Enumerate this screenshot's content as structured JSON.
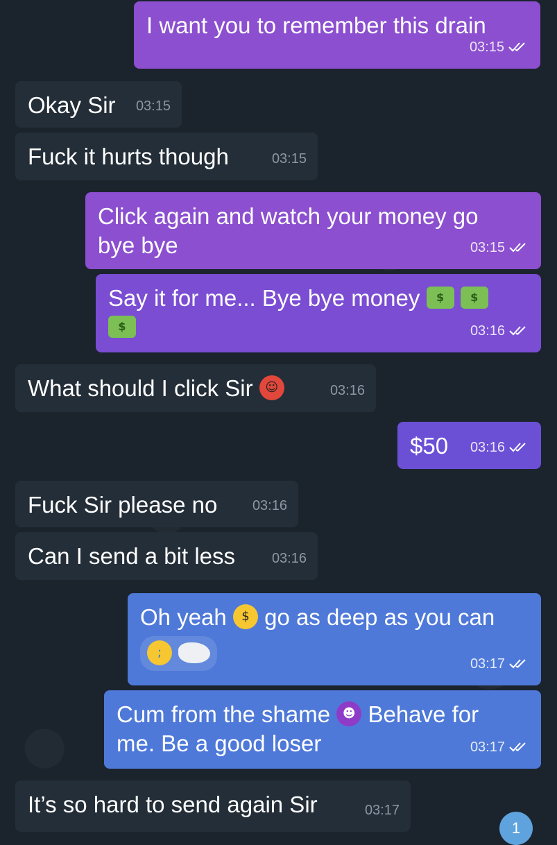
{
  "colors": {
    "background": "#1b232d",
    "incoming": "#242e38",
    "outgoing_purple": "#8b4fcf",
    "outgoing_violet": "#6b50d6",
    "outgoing_blue": "#4e79d9"
  },
  "messages": [
    {
      "dir": "out",
      "text": "I want you to remember this drain",
      "time": "03:15"
    },
    {
      "dir": "in",
      "text": "Okay Sir",
      "time": "03:15"
    },
    {
      "dir": "in",
      "text": "Fuck it hurts though",
      "time": "03:15"
    },
    {
      "dir": "out",
      "text_line1": "Click again and watch your money go",
      "text_line2": "bye bye",
      "time": "03:15"
    },
    {
      "dir": "out",
      "text": "Say it for me... Bye bye money",
      "time": "03:16",
      "emojis": [
        "money-with-wings-icon",
        "money-with-wings-icon",
        "money-with-wings-icon"
      ]
    },
    {
      "dir": "in",
      "text": "What should I click Sir",
      "time": "03:16",
      "emojis": [
        "hot-face-icon"
      ]
    },
    {
      "dir": "out",
      "text": "$50",
      "time": "03:16"
    },
    {
      "dir": "in",
      "text": "Fuck Sir please no",
      "time": "03:16"
    },
    {
      "dir": "in",
      "text": "Can I send a bit less",
      "time": "03:16"
    },
    {
      "dir": "out",
      "text_a": "Oh yeah",
      "text_b": "go as deep as you can",
      "time": "03:17",
      "emojis": [
        "money-mouth-face-icon",
        "loudly-crying-face-icon",
        "redacted-blob-icon"
      ]
    },
    {
      "dir": "out",
      "text_a": "Cum from the shame",
      "text_b": "Behave for",
      "text_line2": "me. Be a good loser",
      "time": "03:17",
      "emojis": [
        "smiling-devil-icon"
      ]
    },
    {
      "dir": "in",
      "text": "It’s so hard to send again Sir",
      "time": "03:17"
    }
  ],
  "unread_badge": "1"
}
